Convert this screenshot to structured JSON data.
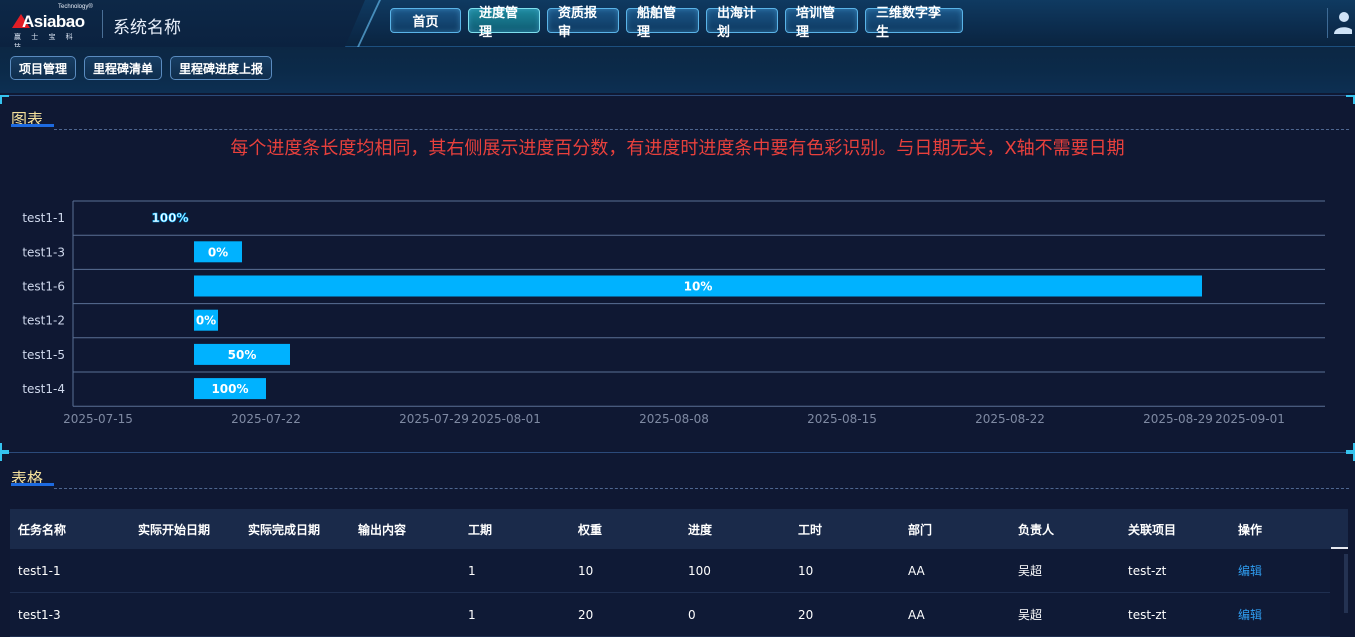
{
  "header": {
    "logo_word": "Asiabao",
    "logo_tech": "Technology®",
    "logo_cn": "赢 士 宝 科 技",
    "system_name": "系统名称",
    "nav": [
      {
        "label": "首页",
        "active": false
      },
      {
        "label": "进度管理",
        "active": true
      },
      {
        "label": "资质报审",
        "active": false
      },
      {
        "label": "船舶管理",
        "active": false
      },
      {
        "label": "出海计划",
        "active": false
      },
      {
        "label": "培训管理",
        "active": false
      },
      {
        "label": "三维数字孪生",
        "active": false
      }
    ],
    "user_icon": "user-avatar-icon"
  },
  "subnav": [
    "项目管理",
    "里程碑清单",
    "里程碑进度上报"
  ],
  "chart_panel": {
    "title": "图表",
    "note": "每个进度条长度均相同，其右侧展示进度百分数，有进度时进度条中要有色彩识别。与日期无关，X轴不需要日期"
  },
  "chart_data": {
    "type": "bar",
    "orientation": "horizontal-gantt",
    "categories": [
      "test1-1",
      "test1-3",
      "test1-6",
      "test1-2",
      "test1-5",
      "test1-4"
    ],
    "bars": [
      {
        "task": "test1-1",
        "start": "2025-07-18",
        "end": "2025-07-18",
        "label": "100%"
      },
      {
        "task": "test1-3",
        "start": "2025-07-19",
        "end": "2025-07-21",
        "label": "0%"
      },
      {
        "task": "test1-6",
        "start": "2025-07-19",
        "end": "2025-08-30",
        "label": "10%"
      },
      {
        "task": "test1-2",
        "start": "2025-07-19",
        "end": "2025-07-20",
        "label": "0%"
      },
      {
        "task": "test1-5",
        "start": "2025-07-19",
        "end": "2025-07-23",
        "label": "50%"
      },
      {
        "task": "test1-4",
        "start": "2025-07-19",
        "end": "2025-07-22",
        "label": "100%"
      }
    ],
    "x_ticks": [
      "2025-07-15",
      "2025-07-22",
      "2025-07-29",
      "2025-08-01",
      "2025-08-08",
      "2025-08-15",
      "2025-08-22",
      "2025-08-29",
      "2025-09-01"
    ],
    "xlim": [
      "2025-07-15",
      "2025-09-01"
    ],
    "bar_color": "#00b2ff",
    "grid": true
  },
  "table_panel": {
    "title": "表格",
    "columns": [
      "任务名称",
      "实际开始日期",
      "实际完成日期",
      "输出内容",
      "工期",
      "权重",
      "进度",
      "工时",
      "部门",
      "负责人",
      "关联项目",
      "操作"
    ],
    "rows": [
      [
        "test1-1",
        "",
        "",
        "",
        "1",
        "10",
        "100",
        "10",
        "AA",
        "吴超",
        "test-zt",
        "编辑"
      ],
      [
        "test1-3",
        "",
        "",
        "",
        "1",
        "20",
        "0",
        "20",
        "AA",
        "吴超",
        "test-zt",
        "编辑"
      ]
    ]
  },
  "colors": {
    "accent": "#35c3ef",
    "panel_title": "#f3df9c",
    "note": "#e8403c",
    "link": "#2f9df0"
  }
}
